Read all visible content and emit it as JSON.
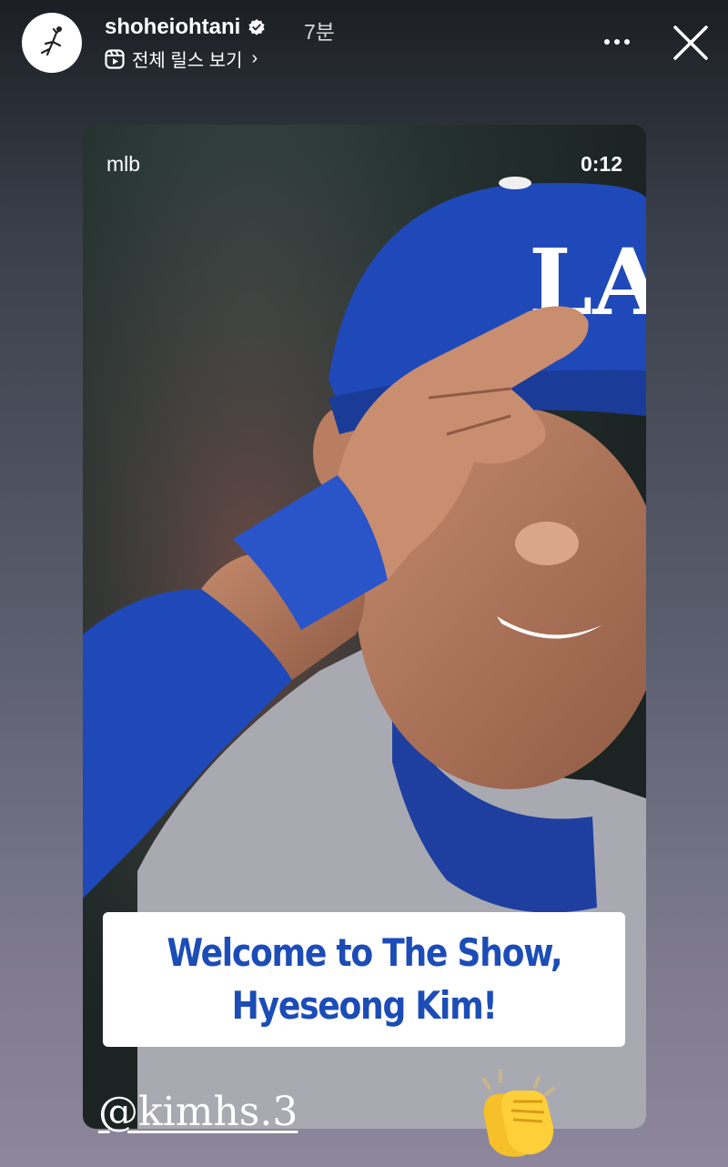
{
  "header": {
    "username": "shoheiohtani",
    "time_ago": "7분",
    "reels_link_label": "전체 릴스 보기",
    "reels_chevron": "›"
  },
  "story": {
    "source_label": "mlb",
    "duration": "0:12",
    "cap_logo": "LA",
    "caption": {
      "line1": "Welcome to The Show,",
      "line2": "Hyeseong Kim!"
    }
  },
  "mention": "@kimhs.3",
  "colors": {
    "caption_text": "#1c4db7",
    "dodger_blue": "#1f49b8",
    "verified_badge": "#ffffff"
  },
  "icons": {
    "avatar": "player-sketch-avatar",
    "verified": "verified-badge-icon",
    "reels": "reels-icon",
    "more": "more-icon",
    "close": "close-icon",
    "clap": "clapping-hands-icon"
  }
}
